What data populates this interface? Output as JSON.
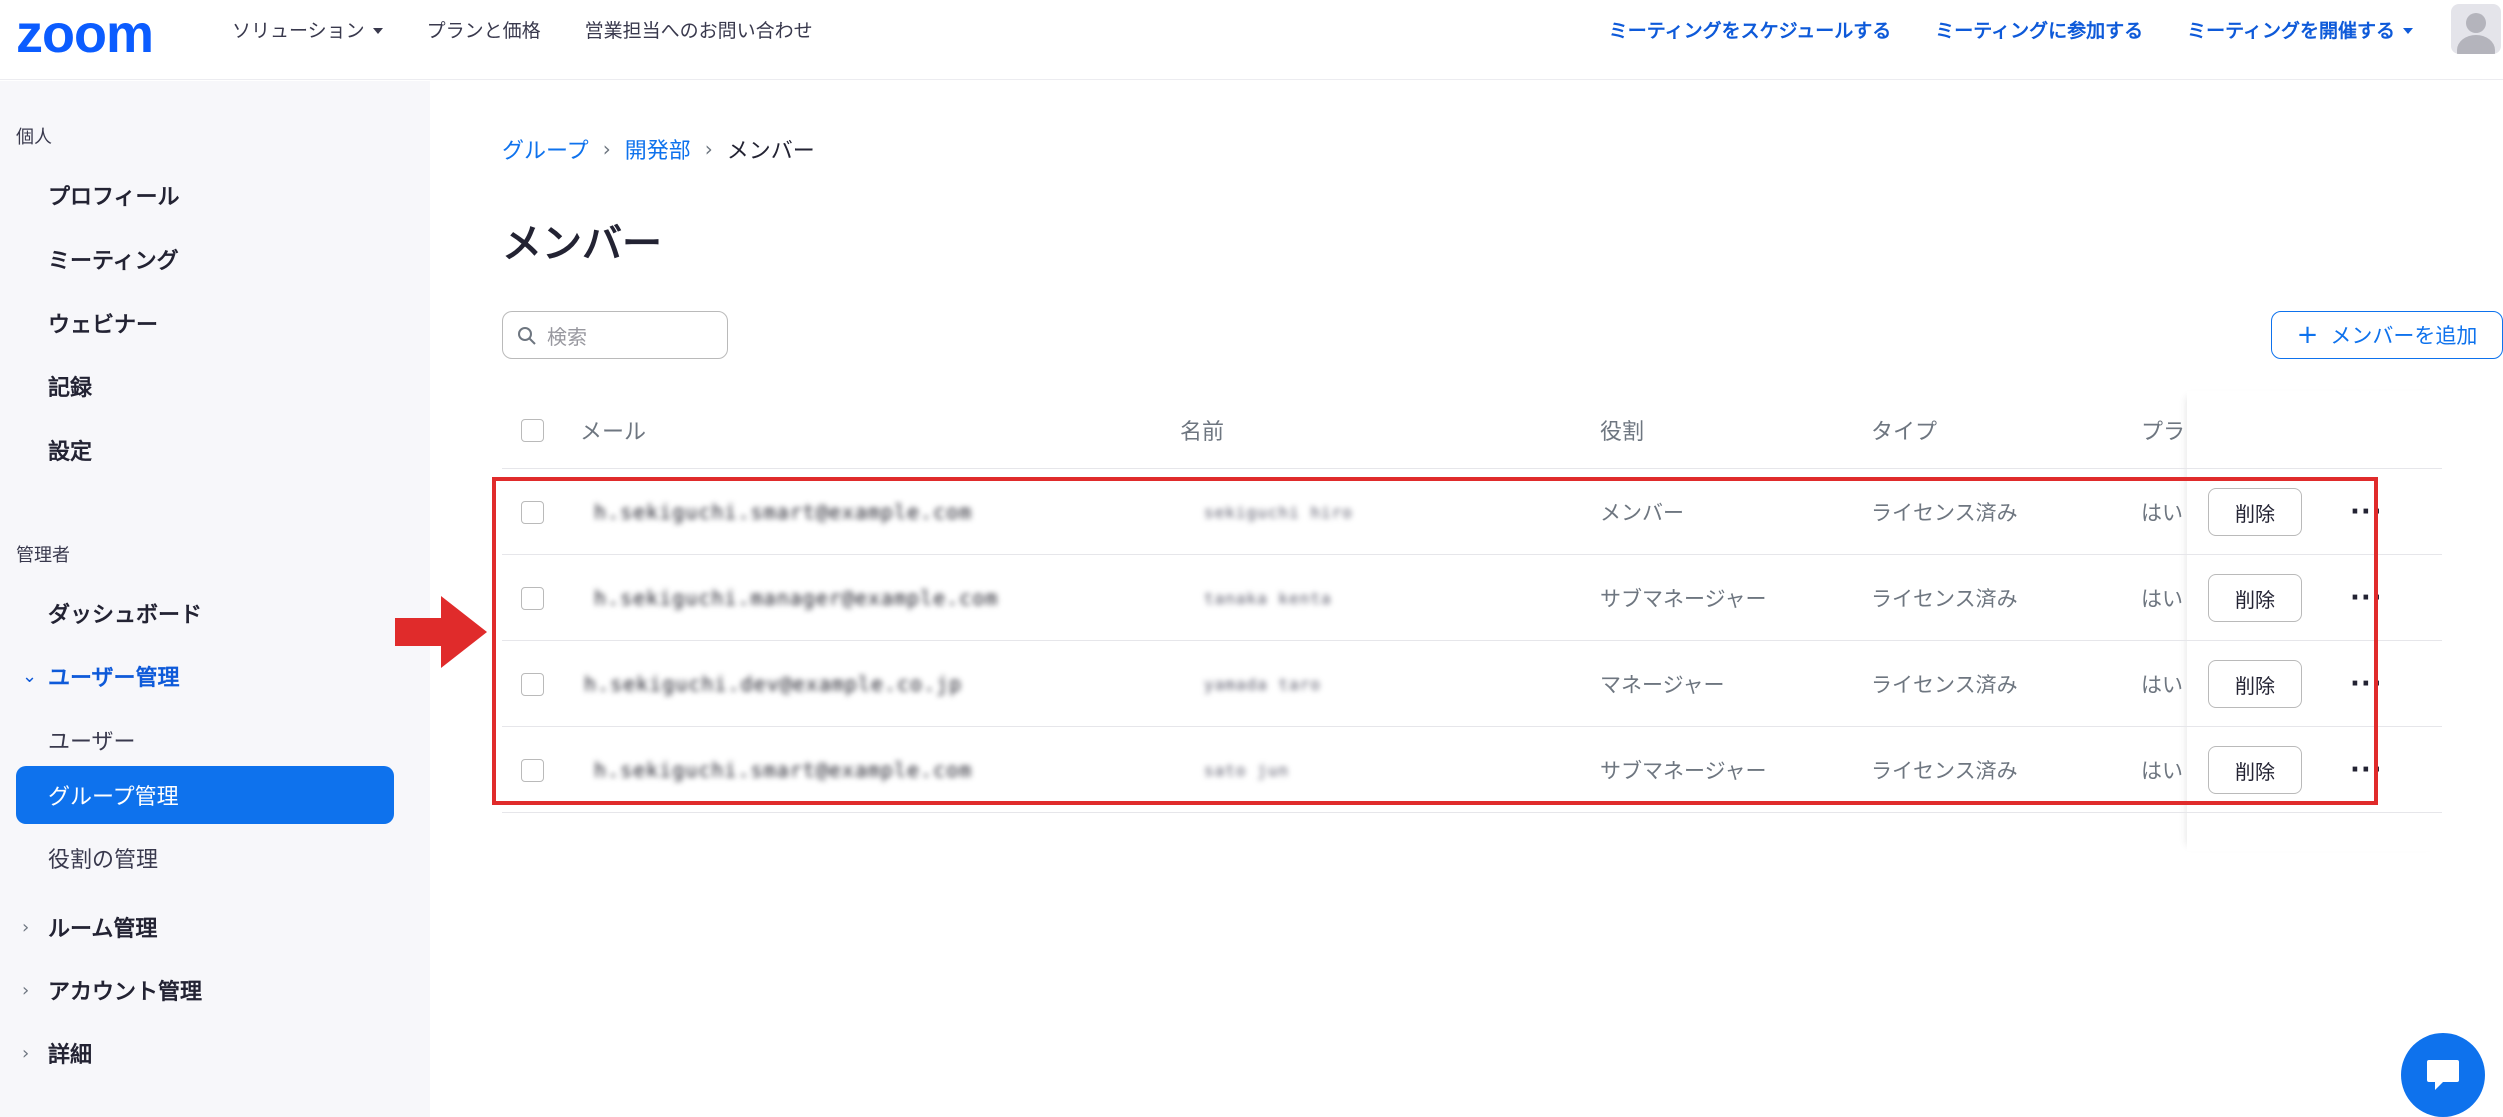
{
  "topnav": {
    "logo": "zoom",
    "left_items": [
      {
        "label": "ソリューション",
        "has_dropdown": true
      },
      {
        "label": "プランと価格",
        "has_dropdown": false
      },
      {
        "label": "営業担当へのお問い合わせ",
        "has_dropdown": false
      }
    ],
    "right_items": [
      {
        "label": "ミーティングをスケジュールする",
        "has_dropdown": false
      },
      {
        "label": "ミーティングに参加する",
        "has_dropdown": false
      },
      {
        "label": "ミーティングを開催する",
        "has_dropdown": true
      }
    ],
    "avatar_icon": "user-avatar-icon"
  },
  "sidebar": {
    "personal_heading": "個人",
    "personal_items": [
      "プロフィール",
      "ミーティング",
      "ウェビナー",
      "記録",
      "設定"
    ],
    "admin_heading": "管理者",
    "dashboard": "ダッシュボード",
    "user_mgmt": {
      "label": "ユーザー管理",
      "expanded": true,
      "children": [
        "ユーザー",
        "グループ管理",
        "役割の管理"
      ],
      "active_child": "グループ管理"
    },
    "collapsed_items": [
      "ルーム管理",
      "アカウント管理",
      "詳細"
    ]
  },
  "breadcrumb": {
    "items": [
      "グループ",
      "開発部"
    ],
    "current": "メンバー"
  },
  "page_title": "メンバー",
  "search": {
    "placeholder": "検索",
    "value": ""
  },
  "add_button": {
    "label": "メンバーを追加",
    "icon": "plus-icon"
  },
  "table": {
    "headers": {
      "email": "メール",
      "name": "名前",
      "role": "役割",
      "type": "タイプ",
      "plan": "プラ"
    },
    "rows": [
      {
        "email": "h.sekiguchi.smart@example.com",
        "name": "sekiguchi hiro",
        "role": "メンバー",
        "type": "ライセンス済み",
        "plan": "はい",
        "delete": "削除"
      },
      {
        "email": "h.sekiguchi.manager@example.com",
        "name": "tanaka kenta",
        "role": "サブマネージャー",
        "type": "ライセンス済み",
        "plan": "はい",
        "delete": "削除"
      },
      {
        "email": "h.sekiguchi.dev@example.co.jp",
        "name": "yamada taro",
        "role": "マネージャー",
        "type": "ライセンス済み",
        "plan": "はい",
        "delete": "削除"
      },
      {
        "email": "h.sekiguchi.smart@example.com",
        "name": "sato jun",
        "role": "サブマネージャー",
        "type": "ライセンス済み",
        "plan": "はい",
        "delete": "削除"
      }
    ]
  },
  "colors": {
    "brand": "#0b5cff",
    "accent": "#0e72ed",
    "annotation": "#e02b2b"
  }
}
